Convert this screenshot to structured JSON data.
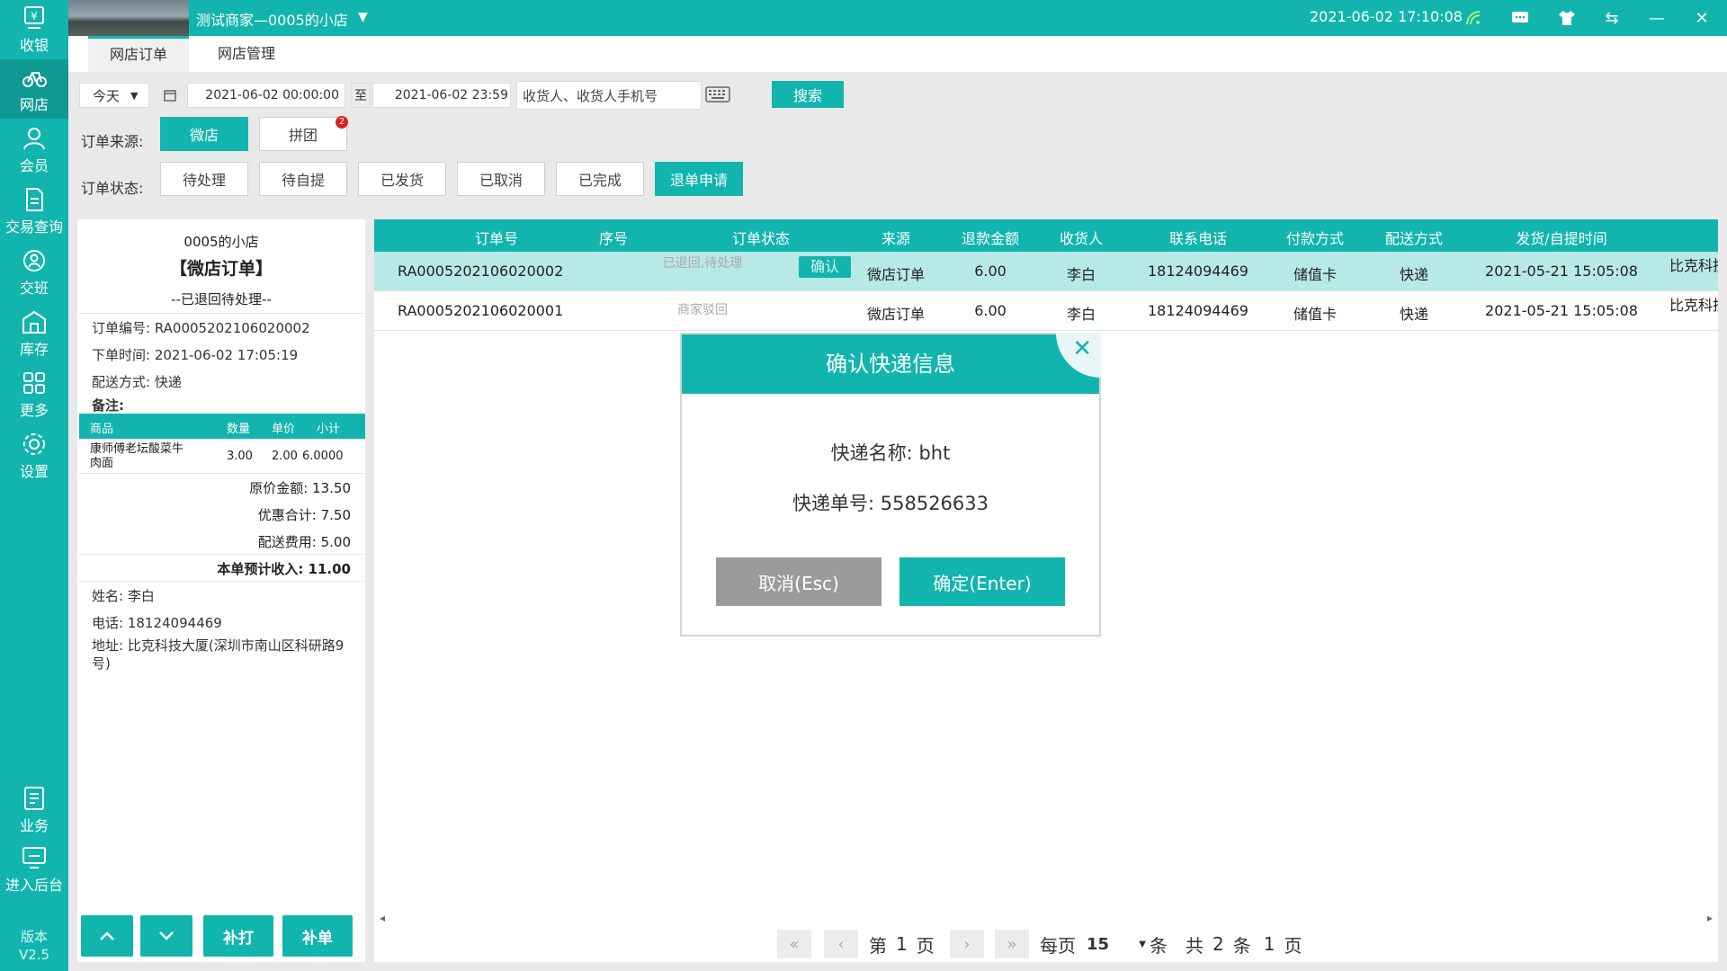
{
  "sidebar": {
    "items": [
      {
        "label": "收银",
        "icon": "cashier-icon"
      },
      {
        "label": "网店",
        "icon": "bike-icon"
      },
      {
        "label": "会员",
        "icon": "member-icon"
      },
      {
        "label": "交易查询",
        "icon": "document-icon"
      },
      {
        "label": "交班",
        "icon": "handover-icon"
      },
      {
        "label": "库存",
        "icon": "warehouse-icon"
      },
      {
        "label": "更多",
        "icon": "grid-icon"
      },
      {
        "label": "设置",
        "icon": "gear-icon"
      },
      {
        "label": "业务",
        "icon": "business-icon"
      },
      {
        "label": "进入后台",
        "icon": "monitor-icon"
      }
    ],
    "version_label": "版本",
    "version": "V2.5"
  },
  "topbar": {
    "store": "测试商家—0005的小店",
    "datetime": "2021-06-02 17:10:08"
  },
  "tabs": [
    "网店订单",
    "网店管理"
  ],
  "filter": {
    "range": "今天",
    "start": "2021-06-02 00:00:00",
    "to": "至",
    "end": "2021-06-02 23:59",
    "search_placeholder": "收货人、收货人手机号",
    "search_btn": "搜索",
    "source_label": "订单来源:",
    "sources": [
      "微店",
      "拼团"
    ],
    "pintuan_badge": "2",
    "status_label": "订单状态:",
    "statuses": [
      "待处理",
      "待自提",
      "已发货",
      "已取消",
      "已完成",
      "退单申请"
    ]
  },
  "detail": {
    "shop": "0005的小店",
    "type": "【微店订单】",
    "state": "--已退回待处理--",
    "order_no_label": "订单编号:",
    "order_no": "RA0005202106020002",
    "time_label": "下单时间:",
    "time": "2021-06-02 17:05:19",
    "delivery_label": "配送方式:",
    "delivery": "快递",
    "remark_label": "备注:",
    "goods_headers": [
      "商品",
      "数量",
      "单价",
      "小计"
    ],
    "goods": [
      {
        "name": "康师傅老坛酸菜牛肉面",
        "qty": "3.00",
        "price": "2.00",
        "subtotal": "6.0000"
      }
    ],
    "orig_label": "原价金额:",
    "orig": "13.50",
    "discount_label": "优惠合计:",
    "discount": "7.50",
    "fee_label": "配送费用:",
    "fee": "5.00",
    "income_label": "本单预计收入:",
    "income": "11.00",
    "name_label": "姓名:",
    "name": "李白",
    "phone_label": "电话:",
    "phone": "18124094469",
    "address_label": "地址:",
    "address": "比克科技大厦(深圳市南山区科研路9号)",
    "buttons": [
      "补打",
      "补单"
    ]
  },
  "table": {
    "headers": [
      "订单号",
      "序号",
      "订单状态",
      "来源",
      "退款金额",
      "收货人",
      "联系电话",
      "付款方式",
      "配送方式",
      "发货/自提时间"
    ],
    "rows": [
      {
        "order": "RA0005202106020002",
        "seq": "",
        "status": "已退回,待处理",
        "action": "确认",
        "source": "微店订单",
        "refund": "6.00",
        "receiver": "李白",
        "phone": "18124094469",
        "pay": "储值卡",
        "delivery": "快递",
        "time": "2021-05-21 15:05:08",
        "addr": "比克科技"
      },
      {
        "order": "RA0005202106020001",
        "seq": "",
        "status": "商家驳回",
        "action": "",
        "source": "微店订单",
        "refund": "6.00",
        "receiver": "李白",
        "phone": "18124094469",
        "pay": "储值卡",
        "delivery": "快递",
        "time": "2021-05-21 15:05:08",
        "addr": "比克科技"
      }
    ]
  },
  "pagination": {
    "page_prefix": "第",
    "page": "1",
    "page_suffix": "页",
    "per_page_label": "每页",
    "per_page": "15",
    "per_page_unit": "条",
    "total_prefix": "共",
    "total": "2",
    "total_unit": "条",
    "pages": "1",
    "pages_unit": "页"
  },
  "modal": {
    "title": "确认快递信息",
    "courier_label": "快递名称:",
    "courier": "bht",
    "tracking_label": "快递单号:",
    "tracking": "558526633",
    "cancel": "取消(Esc)",
    "confirm": "确定(Enter)"
  },
  "colors": {
    "accent": "#12b5ae",
    "cancel": "#9b9b9b",
    "badge": "#e02020"
  }
}
